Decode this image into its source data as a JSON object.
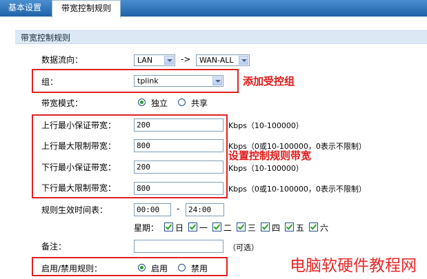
{
  "tabs": [
    {
      "label": "基本设置"
    },
    {
      "label": "带宽控制规则"
    }
  ],
  "panel": {
    "title": "带宽控制规则"
  },
  "flow": {
    "label": "数据流向：",
    "from": "LAN",
    "arrow": "->",
    "to": "WAN-ALL"
  },
  "group": {
    "label": "组：",
    "value": "tplink"
  },
  "mode": {
    "label": "带宽模式：",
    "opt1": "独立",
    "opt2": "共享",
    "selected": "独立"
  },
  "up_min": {
    "label": "上行最小保证带宽：",
    "value": "200",
    "hint": "Kbps（10-100000）"
  },
  "up_max": {
    "label": "上行最大限制带宽：",
    "value": "800",
    "hint": "Kbps（0或10-100000，0表示不限制）"
  },
  "down_min": {
    "label": "下行最小保证带宽：",
    "value": "200",
    "hint": "Kbps（10-100000）"
  },
  "down_max": {
    "label": "下行最大限制带宽：",
    "value": "800",
    "hint": "Kbps（0或10-100000，0表示不限制）"
  },
  "schedule": {
    "label": "规则生效时间表：",
    "start": "00:00",
    "dash": "-",
    "end": "24:00"
  },
  "week": {
    "label": "星期：",
    "days": [
      "日",
      "一",
      "二",
      "三",
      "四",
      "五",
      "六"
    ]
  },
  "note": {
    "label": "备注：",
    "value": "",
    "hint": "（可选）"
  },
  "enable": {
    "label": "启用/禁用规则：",
    "opt1": "启用",
    "opt2": "禁用",
    "selected": "启用"
  },
  "annotations": {
    "group": "添加受控组",
    "bandwidth": "设置控制规则带宽"
  },
  "watermark": "电脑软硬件教程网",
  "colors": {
    "accent": "#1f62a8",
    "annotation": "#e01818"
  }
}
